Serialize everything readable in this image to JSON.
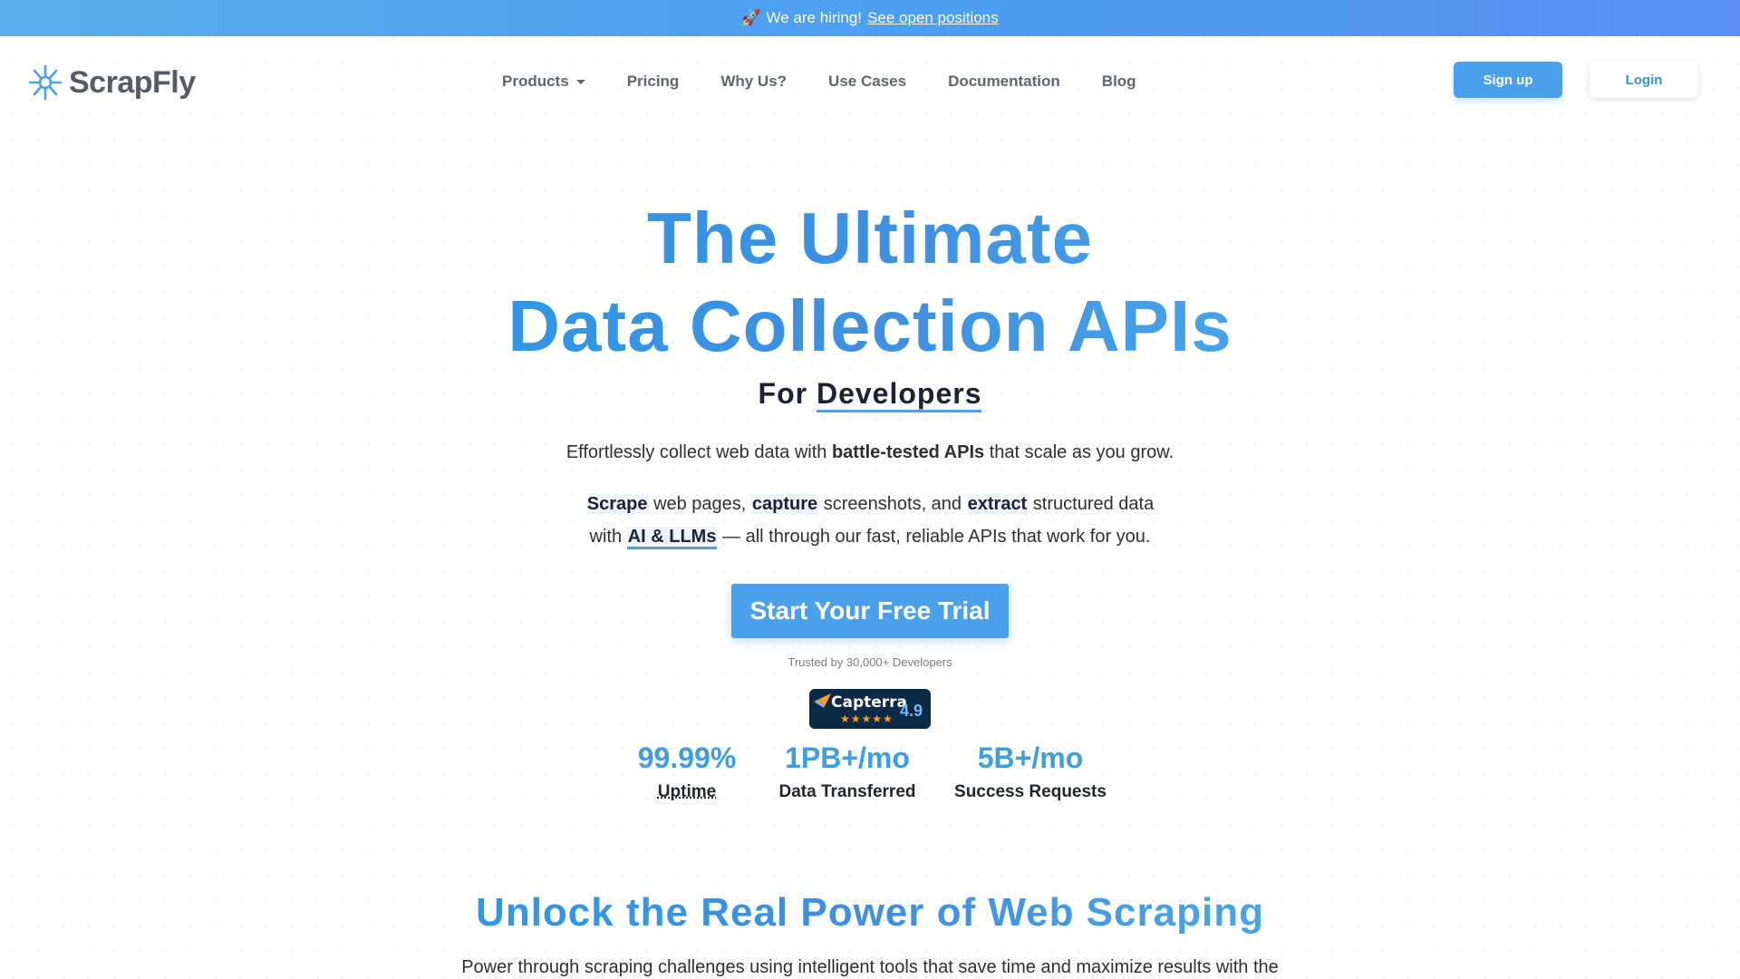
{
  "banner": {
    "emoji": "🚀",
    "text": "We are hiring!",
    "link": "See open positions"
  },
  "nav": {
    "logo_text": "ScrapFly",
    "menu": [
      {
        "label": "Products",
        "has_caret": true
      },
      {
        "label": "Pricing"
      },
      {
        "label": "Why Us?"
      },
      {
        "label": "Use Cases"
      },
      {
        "label": "Documentation"
      },
      {
        "label": "Blog"
      }
    ],
    "signup": "Sign up",
    "login": "Login"
  },
  "hero": {
    "title_line1": "The Ultimate",
    "title_line2": "Data Collection APIs",
    "for_prefix": "For",
    "for_word": "Developers",
    "p1": {
      "before": "Effortlessly collect web data with",
      "bold": "battle-tested APIs",
      "after": "that scale as you grow."
    },
    "p2": {
      "w1": "Scrape",
      "t1": "web pages,",
      "w2": "capture",
      "t2": "screenshots, and",
      "w3": "extract",
      "t3": "structured data",
      "t4": "with",
      "w4": "AI & LLMs",
      "t5": "— all through our fast, reliable APIs that work for you."
    },
    "cta": "Start Your Free Trial",
    "trusted": "Trusted by 30,000+ Developers",
    "capterra": {
      "name": "Capterra",
      "stars": "★★★★★",
      "rating": "4.9"
    }
  },
  "stats": [
    {
      "value": "99.99%",
      "label": "Uptime"
    },
    {
      "value": "1PB+/mo",
      "label": "Data Transferred"
    },
    {
      "value": "5B+/mo",
      "label": "Success Requests"
    }
  ],
  "section2": {
    "title": "Unlock the Real Power of Web Scraping",
    "text": "Power through scraping challenges using intelligent tools that save time and maximize results with the"
  },
  "colors": {
    "accent": "#4aa0ea",
    "banner": "#4a9cf0",
    "capterra_bg": "#0b2a46"
  }
}
